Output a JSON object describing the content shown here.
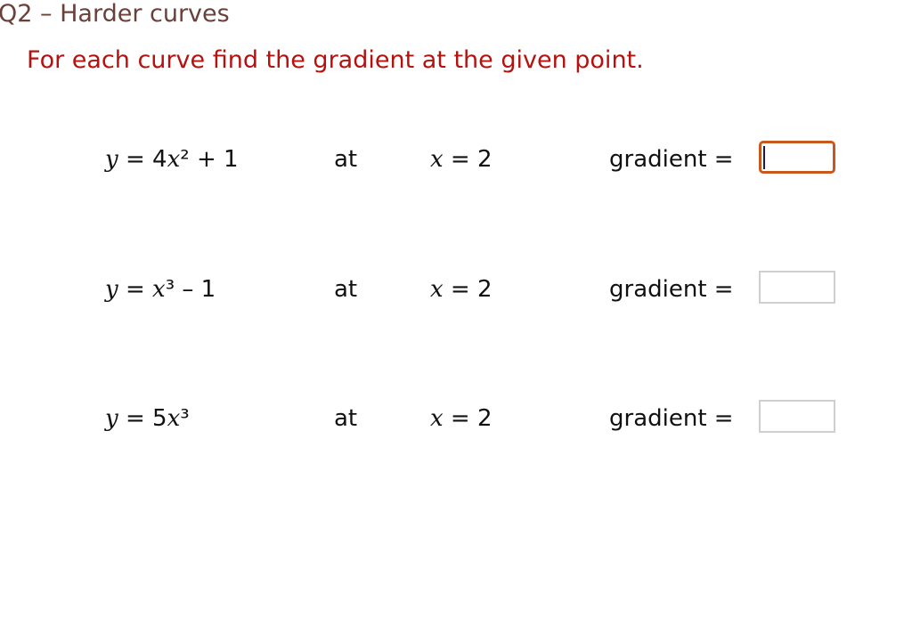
{
  "question": {
    "title": "Q2 – Harder curves",
    "instruction": "For each curve find the gradient at the given point."
  },
  "rows": [
    {
      "equation": {
        "lhs": "y",
        "equals": " = ",
        "parts": [
          {
            "text": "4"
          },
          {
            "text": "x",
            "var": true
          },
          {
            "text": "² + 1"
          }
        ]
      },
      "at_label": "at",
      "point": {
        "var": "x",
        "rest": " = 2"
      },
      "gradient_label": "gradient =",
      "answer_value": "",
      "focused": true
    },
    {
      "equation": {
        "lhs": "y",
        "equals": " = ",
        "parts": [
          {
            "text": "x",
            "var": true
          },
          {
            "text": "³ – 1"
          }
        ]
      },
      "at_label": "at",
      "point": {
        "var": "x",
        "rest": " = 2"
      },
      "gradient_label": "gradient =",
      "answer_value": "",
      "focused": false
    },
    {
      "equation": {
        "lhs": "y",
        "equals": " = ",
        "parts": [
          {
            "text": "5"
          },
          {
            "text": "x",
            "var": true
          },
          {
            "text": "³"
          }
        ]
      },
      "at_label": "at",
      "point": {
        "var": "x",
        "rest": " = 2"
      },
      "gradient_label": "gradient =",
      "answer_value": "",
      "focused": false
    }
  ],
  "colors": {
    "title": "#6b4039",
    "instruction": "#b5120f",
    "focus_border": "#c8581e",
    "input_border": "#cfcfcf"
  }
}
